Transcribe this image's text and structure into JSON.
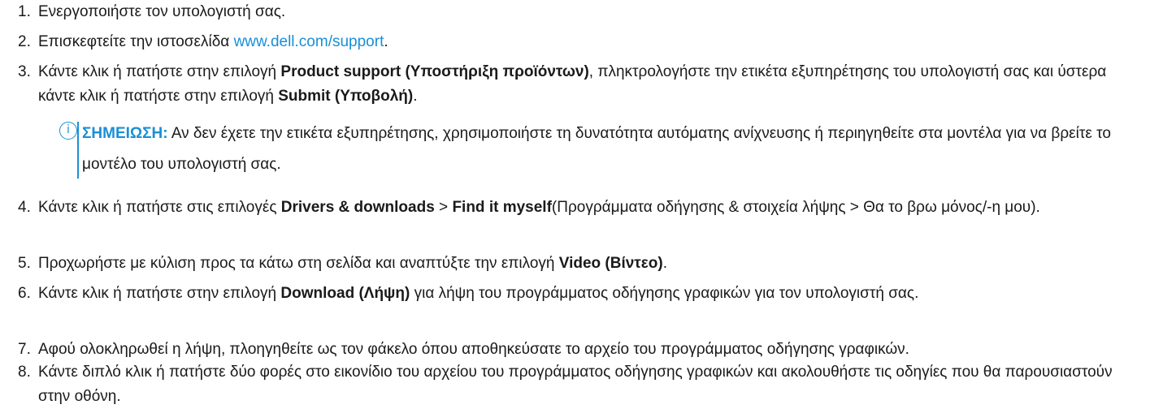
{
  "steps": [
    {
      "num": "1.",
      "text": "Ενεργοποιήστε τον υπολογιστή σας."
    },
    {
      "num": "2.",
      "text_before": "Επισκεφτείτε την ιστοσελίδα ",
      "link": "www.dell.com/support",
      "text_after": "."
    },
    {
      "num": "3.",
      "p1": "Κάντε κλικ ή πατήστε στην επιλογή ",
      "b1": "Product support (Υποστήριξη προϊόντων)",
      "p2": ", πληκτρολογήστε την ετικέτα εξυπηρέτησης του υπολογιστή σας και ύστερα κάντε κλικ ή πατήστε στην επιλογή ",
      "b2": "Submit (Υποβολή)",
      "p3": "."
    },
    {
      "num": "4.",
      "p1": "Κάντε κλικ ή πατήστε στις επιλογές ",
      "b1": "Drivers & downloads",
      "p2": " > ",
      "b2": "Find it myself",
      "p3": "(Προγράμματα οδήγησης & στοιχεία λήψης > Θα το βρω μόνος/-η μου)."
    },
    {
      "num": "5.",
      "p1": "Προχωρήστε με κύλιση προς τα κάτω στη σελίδα και αναπτύξτε την επιλογή ",
      "b1": "Video (Βίντεο)",
      "p2": "."
    },
    {
      "num": "6.",
      "p1": "Κάντε κλικ ή πατήστε στην επιλογή ",
      "b1": "Download (Λήψη)",
      "p2": " για λήψη του προγράμματος οδήγησης γραφικών για τον υπολογιστή σας."
    },
    {
      "num": "7.",
      "text": "Αφού ολοκληρωθεί η λήψη, πλοηγηθείτε ως τον φάκελο όπου αποθηκεύσατε το αρχείο του προγράμματος οδήγησης γραφικών."
    },
    {
      "num": "8.",
      "text": "Κάντε διπλό κλικ ή πατήστε δύο φορές στο εικονίδιο του αρχείου του προγράμματος οδήγησης γραφικών και ακολουθήστε τις οδηγίες που θα παρουσιαστούν στην οθόνη."
    }
  ],
  "note": {
    "label": "ΣΗΜΕΙΩΣΗ:",
    "text": " Αν δεν έχετε την ετικέτα εξυπηρέτησης, χρησιμοποιήστε τη δυνατότητα αυτόματης ανίχνευσης ή περιηγηθείτε στα μοντέλα για να βρείτε το μοντέλο του υπολογιστή σας.",
    "icon": "info-icon",
    "icon_glyph": "i"
  },
  "colors": {
    "accent": "#1a8fd6",
    "text": "#1a1a1a"
  }
}
